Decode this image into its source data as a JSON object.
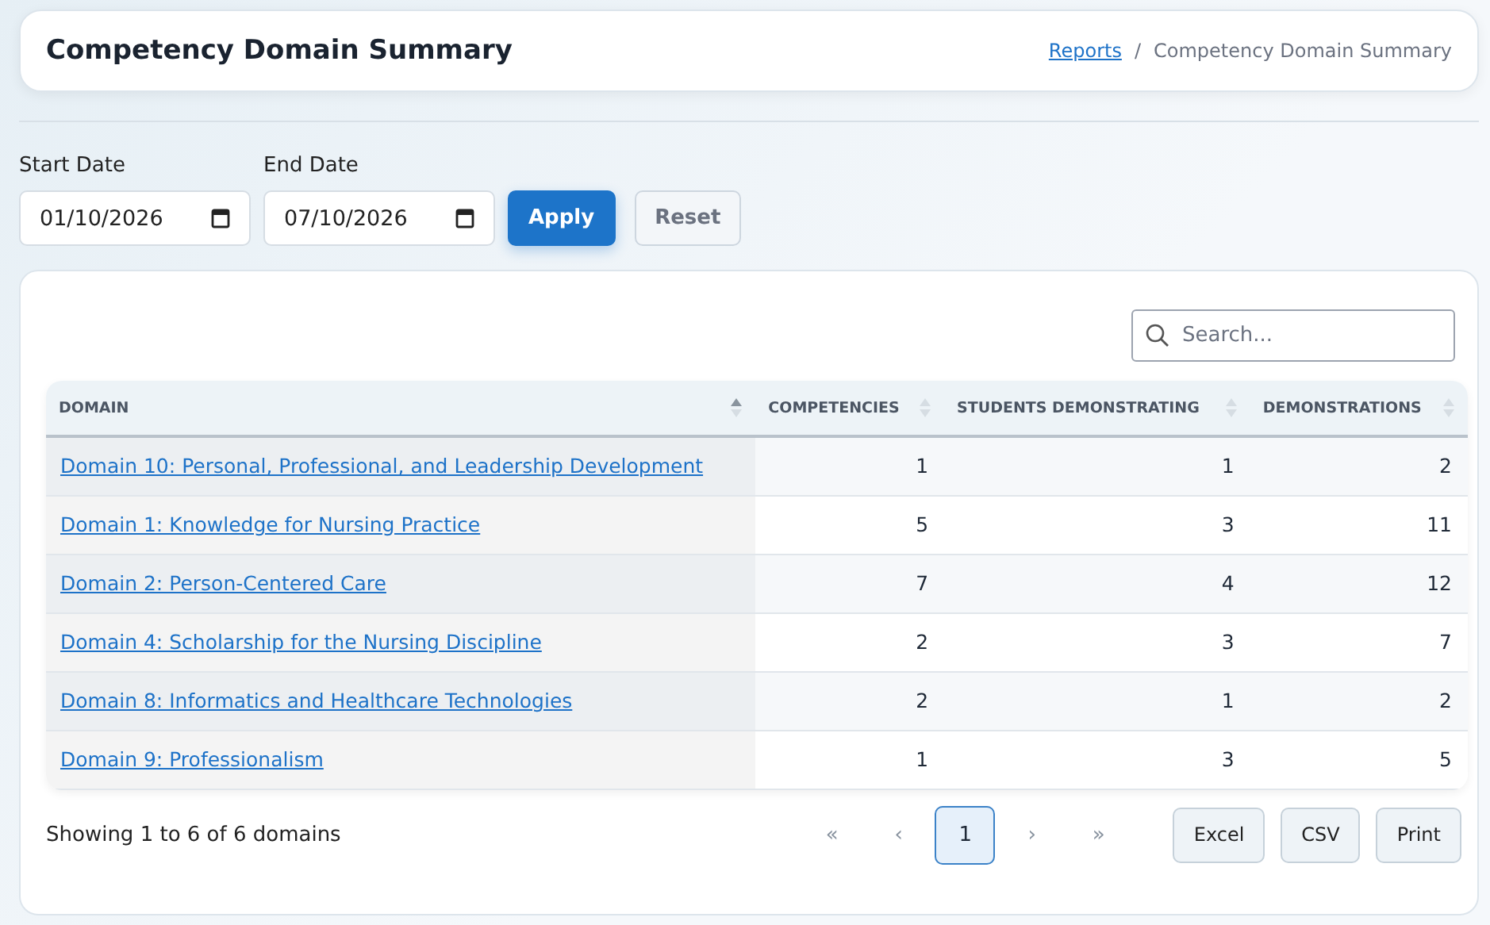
{
  "header": {
    "title": "Competency Domain Summary",
    "breadcrumb": [
      {
        "label": "Reports",
        "link": true
      },
      {
        "label": "Competency Domain Summary",
        "link": false
      }
    ],
    "separator": "/"
  },
  "filters": {
    "start": {
      "label": "Start Date",
      "value": "01/10/2026"
    },
    "end": {
      "label": "End Date",
      "value": "07/10/2026"
    },
    "buttons": [
      {
        "label": "Apply",
        "kind": "primary"
      },
      {
        "label": "Reset",
        "kind": "secondary"
      }
    ]
  },
  "search": {
    "placeholder": "Search..."
  },
  "table": {
    "columns": [
      {
        "label": "DOMAIN",
        "sorted": true
      },
      {
        "label": "COMPETENCIES",
        "sorted": false
      },
      {
        "label": "STUDENTS DEMONSTRATING",
        "sorted": false
      },
      {
        "label": "DEMONSTRATIONS",
        "sorted": false
      }
    ],
    "rows": [
      [
        "Domain 10: Personal, Professional, and Leadership Development",
        "1",
        "1",
        "2"
      ],
      [
        "Domain 1: Knowledge for Nursing Practice",
        "5",
        "3",
        "11"
      ],
      [
        "Domain 2: Person-Centered Care",
        "7",
        "4",
        "12"
      ],
      [
        "Domain 4: Scholarship for the Nursing Discipline",
        "2",
        "3",
        "7"
      ],
      [
        "Domain 8: Informatics and Healthcare Technologies",
        "2",
        "1",
        "2"
      ],
      [
        "Domain 9: Professionalism",
        "1",
        "3",
        "5"
      ]
    ]
  },
  "footer": {
    "info": "Showing 1 to 6 of 6 domains",
    "pages": [
      {
        "label": "«",
        "selected": false
      },
      {
        "label": "‹",
        "selected": false
      },
      {
        "label": "1",
        "selected": true
      },
      {
        "label": "›",
        "selected": false
      },
      {
        "label": "»",
        "selected": false
      }
    ],
    "exports": [
      "Excel",
      "CSV",
      "Print"
    ]
  }
}
